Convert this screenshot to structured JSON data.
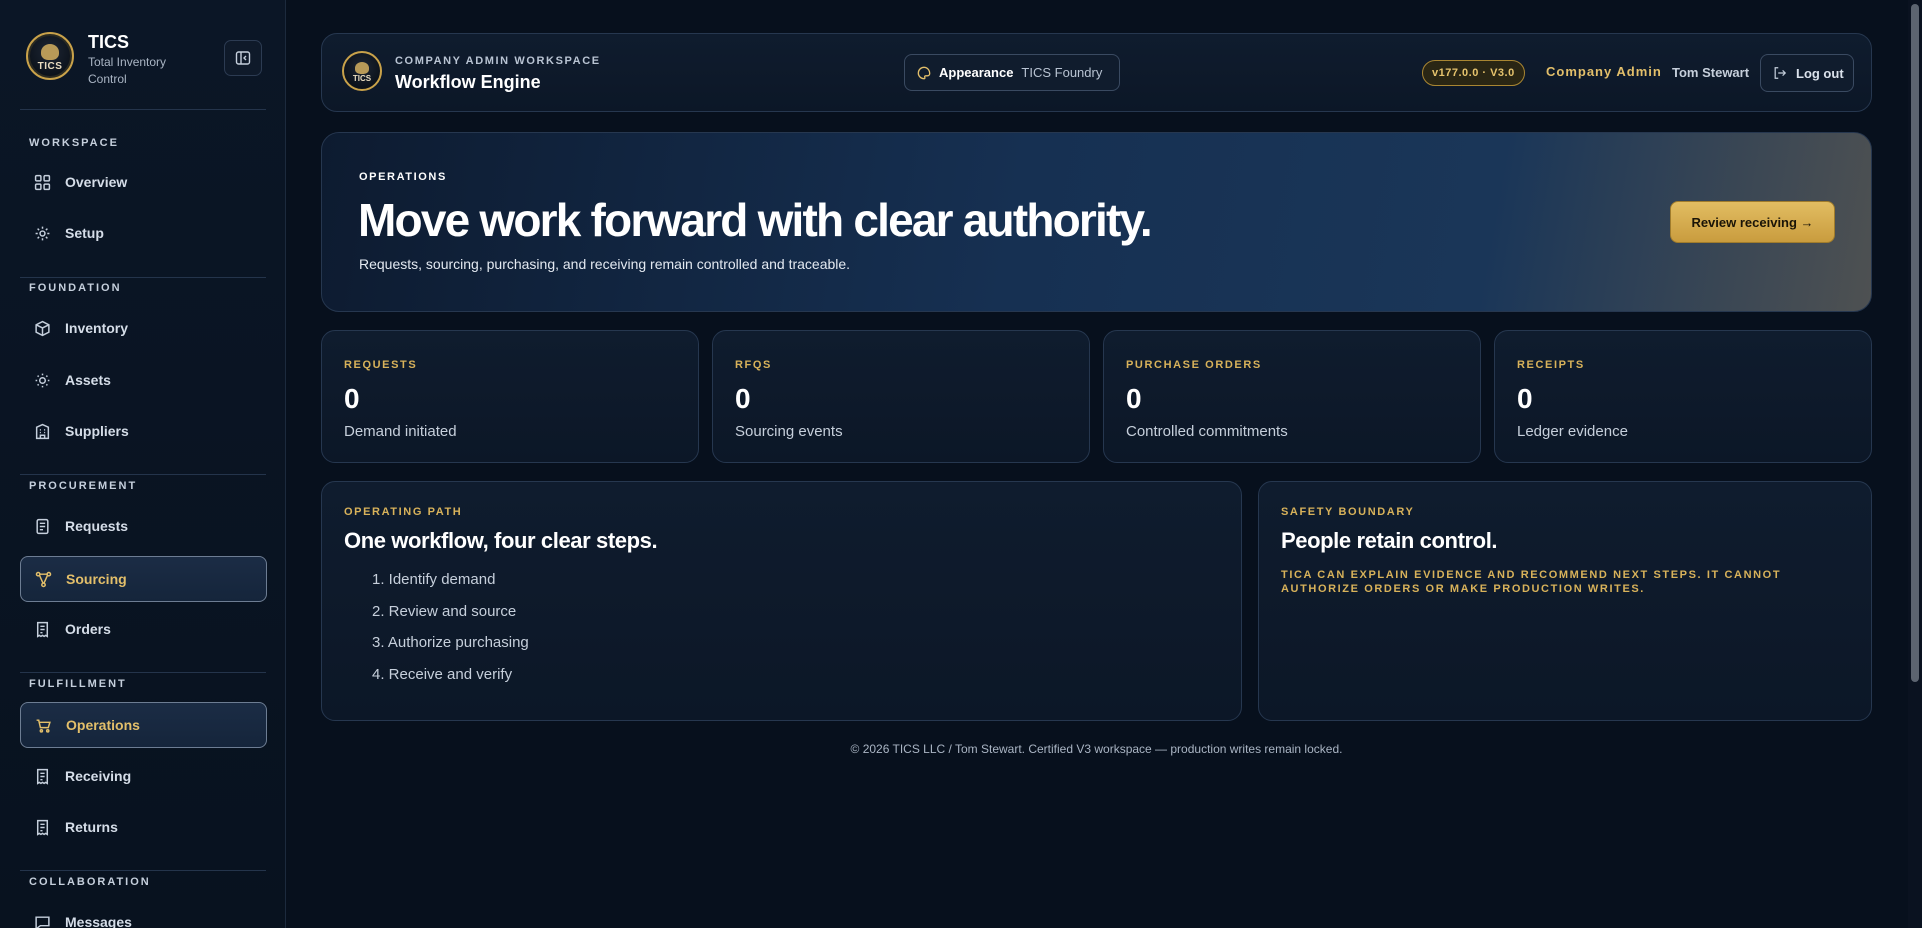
{
  "brand": {
    "logo_text": "TICS",
    "title": "TICS",
    "subtitle": "Total Inventory Control"
  },
  "sidebar": {
    "sections": [
      {
        "title": "WORKSPACE",
        "items": [
          {
            "label": "Overview",
            "icon": "grid-icon"
          },
          {
            "label": "Setup",
            "icon": "gear-icon"
          }
        ]
      },
      {
        "title": "FOUNDATION",
        "items": [
          {
            "label": "Inventory",
            "icon": "box-icon"
          },
          {
            "label": "Assets",
            "icon": "sun-icon"
          },
          {
            "label": "Suppliers",
            "icon": "building-icon"
          }
        ]
      },
      {
        "title": "PROCUREMENT",
        "items": [
          {
            "label": "Requests",
            "icon": "document-icon"
          },
          {
            "label": "Sourcing",
            "icon": "network-icon",
            "active": true
          },
          {
            "label": "Orders",
            "icon": "receipt-icon"
          }
        ]
      },
      {
        "title": "FULFILLMENT",
        "items": [
          {
            "label": "Operations",
            "icon": "cart-icon",
            "active": true
          },
          {
            "label": "Receiving",
            "icon": "receipt-icon"
          },
          {
            "label": "Returns",
            "icon": "receipt-icon"
          }
        ]
      },
      {
        "title": "COLLABORATION",
        "items": [
          {
            "label": "Messages",
            "icon": "chat-icon"
          }
        ]
      }
    ]
  },
  "topbar": {
    "logo_text": "TICS",
    "eyebrow": "COMPANY ADMIN WORKSPACE",
    "title": "Workflow Engine",
    "appearance_label": "Appearance",
    "appearance_value": "TICS Foundry",
    "version": "v177.0.0 · V3.0",
    "role": "Company Admin",
    "user": "Tom Stewart",
    "logout": "Log out"
  },
  "hero": {
    "eyebrow": "OPERATIONS",
    "title": "Move work forward with clear authority.",
    "subtitle": "Requests, sourcing, purchasing, and receiving remain controlled and traceable.",
    "button": "Review receiving →"
  },
  "stats": [
    {
      "label": "REQUESTS",
      "value": "0",
      "desc": "Demand initiated"
    },
    {
      "label": "RFQS",
      "value": "0",
      "desc": "Sourcing events"
    },
    {
      "label": "PURCHASE ORDERS",
      "value": "0",
      "desc": "Controlled commitments"
    },
    {
      "label": "RECEIPTS",
      "value": "0",
      "desc": "Ledger evidence"
    }
  ],
  "operating_path": {
    "eyebrow": "OPERATING PATH",
    "title": "One workflow, four clear steps.",
    "steps": [
      "1. Identify demand",
      "2. Review and source",
      "3. Authorize purchasing",
      "4. Receive and verify"
    ]
  },
  "safety": {
    "eyebrow": "SAFETY BOUNDARY",
    "title": "People retain control.",
    "note": "TICA CAN EXPLAIN EVIDENCE AND RECOMMEND NEXT STEPS. IT CANNOT AUTHORIZE ORDERS OR MAKE PRODUCTION WRITES."
  },
  "footer": "© 2026 TICS LLC / Tom Stewart. Certified V3 workspace — production writes remain locked.",
  "colors": {
    "accent_gold": "#e3bf6a",
    "background": "#07101d",
    "panel": "#0f1c2e"
  }
}
